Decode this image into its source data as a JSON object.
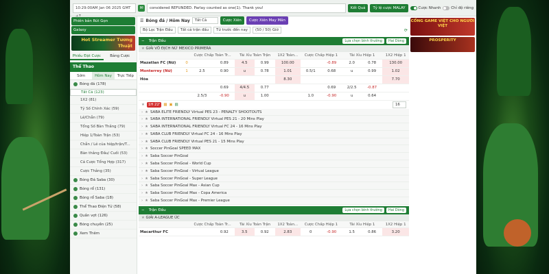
{
  "topbar": {
    "time": "10:29:00AM Jan 06 2025 GMT +7",
    "marquee": "considered REFUNDED. Parlay counted as one(1). Thank you!",
    "result_btn": "Kết Quả",
    "odds_type": "Tỷ lệ cược MALAY",
    "toggle_quick": "Cược Nhanh",
    "toggle_favorite": "Chỉ độ riêng"
  },
  "sidebar": {
    "btn_flat": "Phiên bản Rút Gọn",
    "btn_galaxy": "Galaxy",
    "banner_text": "Hot Streamer Tương Thuật",
    "tab_left": "Phiếu Đặt Cược",
    "tab_right": "Bảng Cược",
    "sport_header": "Thể Thao",
    "time_tabs": [
      "Sớm",
      "Hôm Nay",
      "Trực Tiếp"
    ],
    "items": [
      {
        "label": "Bóng đá (178)",
        "kind": "top"
      },
      {
        "label": "Tất Cả (123)",
        "kind": "sel"
      },
      {
        "label": "1X2 (81)",
        "kind": "sub"
      },
      {
        "label": "Tỷ Số Chính Xác (59)",
        "kind": "sub"
      },
      {
        "label": "Lẻ/Chẵn (79)",
        "kind": "sub"
      },
      {
        "label": "Tổng Số Bàn Thắng (79)",
        "kind": "sub"
      },
      {
        "label": "Hiệp 1/Toàn Trận (53)",
        "kind": "sub"
      },
      {
        "label": "Chẵn / Lẻ của hiệp/trận/T...",
        "kind": "sub"
      },
      {
        "label": "Bàn thắng Đầu/ Cuối (53)",
        "kind": "sub"
      },
      {
        "label": "Cá Cược Tổng Hợp (317)",
        "kind": "sub"
      },
      {
        "label": "Cược Thắng (35)",
        "kind": "sub"
      },
      {
        "label": "Bóng Đá Saba (30)",
        "kind": "top"
      },
      {
        "label": "Bóng rổ (131)",
        "kind": "top"
      },
      {
        "label": "Bóng rổ Saba (18)",
        "kind": "top"
      },
      {
        "label": "Thể Thao Điện Tử (58)",
        "kind": "top"
      },
      {
        "label": "Quần vợt (126)",
        "kind": "top"
      },
      {
        "label": "Bóng chuyền (25)",
        "kind": "top"
      },
      {
        "label": "Xem Thêm",
        "kind": "top"
      }
    ]
  },
  "filters": {
    "mode": "Bóng đá / Hôm Nay",
    "all": "Tất Cả",
    "bet_btn": "Cược Xiên",
    "bet_btn2": "Cược Xiên May Mắn",
    "f1": "Bộ Lọc Trận Đấu",
    "f2": "Tất cả trận đấu",
    "f3": "Từ trước đến nay",
    "page": "(50 / 50) Giờ"
  },
  "section1": {
    "title": "Trận Đấu",
    "chip1": "Lựa chọn bình thường",
    "chip2": "Hai Dòng",
    "league": "GIẢI VÔ ĐỊCH NỮ MEXICO PRIMERA",
    "headers": [
      "",
      "",
      "Cược Chấp Toàn Tr...",
      "Tài Xỉu Toàn Trận",
      "1X2 Toàn...",
      "Cược Chấp Hiệp 1",
      "Tài Xỉu Hiệp 1",
      "1X2 Hiệp 1"
    ],
    "rows": [
      [
        "Mazatlan FC (Nữ)",
        "0",
        "",
        "0.89",
        "4.5",
        "0.99",
        "100.00",
        "",
        "-0.89",
        "2.0",
        "0.78",
        "130.00"
      ],
      [
        "Monterrey (Nữ)",
        "1",
        "2.5",
        "0.90",
        "u",
        "0.78",
        "1.01",
        "0.5/1",
        "0.68",
        "u",
        "0.99",
        "1.02"
      ],
      [
        "Hòa",
        "",
        "",
        "",
        "",
        "",
        "8.30",
        "",
        "",
        "",
        "",
        "7.70"
      ],
      [
        "",
        "",
        "",
        "0.69",
        "4/4.5",
        "0.77",
        "",
        "",
        "0.69",
        "2/2.5",
        "-0.87",
        ""
      ],
      [
        "",
        "",
        "2.5/3",
        "-0.90",
        "u",
        "1.00",
        "",
        "1.0",
        "-0.90",
        "u",
        "0.64",
        ""
      ]
    ]
  },
  "live": {
    "badge": "1H 22'",
    "count": "16"
  },
  "leagues": [
    "SABA ELITE FRIENDLY Virtual PES 23 - PENALTY SHOOTOUTS",
    "SABA INTERNATIONAL FRIENDLY Virtual PES 21 - 20 Mins Play",
    "SABA INTERNATIONAL FRIENDLY Virtual FC 24 - 16 Mins Play",
    "SABA CLUB FRIENDLY Virtual FC 24 - 16 Mins Play",
    "SABA CLUB FRIENDLY Virtual PES 21 - 15 Mins Play",
    "Soccer PinGoal SPEED MAX",
    "Saba Soccer PinGoal",
    "Saba Soccer PinGoal - World Cup",
    "Saba Soccer PinGoal - Virtual League",
    "Saba Soccer PinGoal - Super League",
    "Saba Soccer PinGoal Max - Asian Cup",
    "Saba Soccer PinGoal Max - Copa America",
    "Saba Soccer PinGoal Max - Premier League"
  ],
  "section2": {
    "title": "Trận Đấu",
    "chip1": "Lựa chọn bình thường",
    "chip2": "Hai Dòng",
    "league": "GIẢI A-LEAGUE ÚC",
    "headers": [
      "",
      "",
      "Cược Chấp Toàn Tr...",
      "Tài Xỉu Toàn Trận",
      "1X2 Toàn...",
      "Cược Chấp Hiệp 1",
      "Tài Xỉu Hiệp 1",
      "1X2 Hiệp 1"
    ],
    "row": [
      "Macarthur FC",
      "",
      "",
      "0.92",
      "3.5",
      "0.92",
      "2.83",
      "0",
      "-0.90",
      "1.5",
      "0.86",
      "3.20"
    ]
  },
  "ads": {
    "ad1": "CỔNG GAME VIỆT CHO NGƯỜI VIỆT",
    "ad2": "PROSPERITY"
  }
}
